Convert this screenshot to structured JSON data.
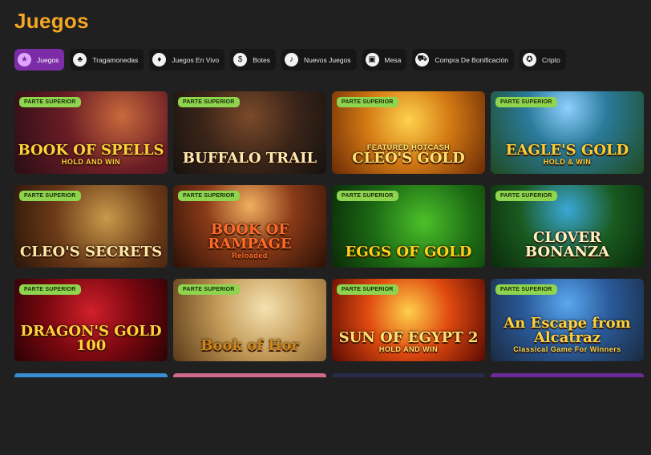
{
  "page": {
    "title": "Juegos"
  },
  "filters": [
    {
      "label": "Juegos",
      "icon": "star-icon",
      "glyph": "★",
      "active": true
    },
    {
      "label": "Tragamonedas",
      "icon": "cherries-icon",
      "glyph": "♣",
      "active": false
    },
    {
      "label": "Juegos En Vivo",
      "icon": "cards-icon",
      "glyph": "♦",
      "active": false
    },
    {
      "label": "Botes",
      "icon": "dollar-icon",
      "glyph": "$",
      "active": false
    },
    {
      "label": "Nuevos Juegos",
      "icon": "bell-icon",
      "glyph": "♪",
      "active": false
    },
    {
      "label": "Mesa",
      "icon": "table-icon",
      "glyph": "▣",
      "active": false
    },
    {
      "label": "Compra De Bonificación",
      "icon": "cart-icon",
      "glyph": "⛟",
      "active": false
    },
    {
      "label": "Cripto",
      "icon": "crypto-icon",
      "glyph": "✪",
      "active": false
    }
  ],
  "badge_label": "PARTE SUPERIOR",
  "games": [
    {
      "title": "BOOK OF SPELLS",
      "sub": "HOLD AND WIN",
      "color": "#ffd23a"
    },
    {
      "title": "BUFFALO TRAIL",
      "sub": "",
      "color": "#ffe9b0"
    },
    {
      "title": "CLEO'S GOLD",
      "sub": "FEATURED HOTCASH",
      "color": "#ffe070"
    },
    {
      "title": "EAGLE'S GOLD",
      "sub": "HOLD & WIN",
      "color": "#ffcc33"
    },
    {
      "title": "CLEO'S SECRETS",
      "sub": "",
      "color": "#ffe7a8"
    },
    {
      "title": "BOOK OF RAMPAGE",
      "sub": "Reloaded",
      "color": "#ff6a2a"
    },
    {
      "title": "EGGS OF GOLD",
      "sub": "",
      "color": "#ffd21a"
    },
    {
      "title": "CLOVER BONANZA",
      "sub": "",
      "color": "#fff2c0"
    },
    {
      "title": "DRAGON'S GOLD 100",
      "sub": "",
      "color": "#ffd23a"
    },
    {
      "title": "Book of Hor",
      "sub": "",
      "color": "#d0861a"
    },
    {
      "title": "SUN OF EGYPT 2",
      "sub": "HOLD AND WIN",
      "color": "#ffe070"
    },
    {
      "title": "An Escape from Alcatraz",
      "sub": "Classical Game For Winners",
      "color": "#ffd23a"
    }
  ]
}
